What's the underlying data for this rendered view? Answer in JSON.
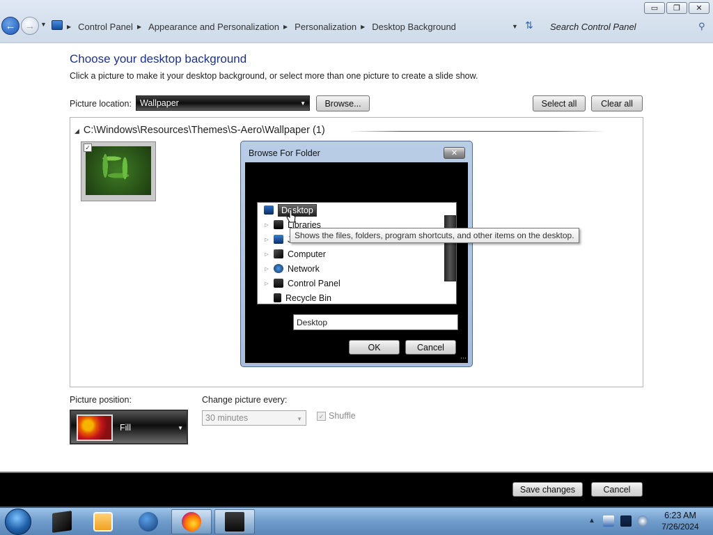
{
  "window": {
    "minimize_glyph": "▭",
    "maximize_glyph": "❐",
    "close_glyph": "✕"
  },
  "address_bar": {
    "back_icon": "back-arrow-icon",
    "forward_icon": "forward-arrow-icon",
    "breadcrumb": [
      "Control Panel",
      "Appearance and Personalization",
      "Personalization",
      "Desktop Background"
    ],
    "search_placeholder": "Search Control Panel"
  },
  "main": {
    "title": "Choose your desktop background",
    "subtitle": "Click a picture to make it your desktop background, or select more than one picture to create a slide show.",
    "picture_location_label": "Picture location:",
    "picture_location_value": "Wallpaper",
    "browse_label": "Browse...",
    "select_all_label": "Select all",
    "clear_all_label": "Clear all",
    "group_header": "C:\\Windows\\Resources\\Themes\\S-Aero\\Wallpaper (1)",
    "thumbnails": [
      {
        "checked": true,
        "subject": "green-leaves"
      }
    ]
  },
  "dialog": {
    "title": "Browse For Folder",
    "close_label": "✕",
    "tree_items": [
      {
        "label": "Desktop",
        "icon": "desktop-icon",
        "selected": true,
        "expandable": false
      },
      {
        "label": "Libraries",
        "icon": "libraries-icon",
        "expandable": true
      },
      {
        "label": "Jo",
        "icon": "user-folder-icon",
        "expandable": true
      },
      {
        "label": "Computer",
        "icon": "computer-icon",
        "expandable": true
      },
      {
        "label": "Network",
        "icon": "network-icon",
        "expandable": true
      },
      {
        "label": "Control Panel",
        "icon": "control-panel-icon",
        "expandable": true
      },
      {
        "label": "Recycle Bin",
        "icon": "recycle-bin-icon",
        "expandable": false
      }
    ],
    "folder_value": "Desktop",
    "ok_label": "OK",
    "cancel_label": "Cancel",
    "tooltip": "Shows the files, folders, program shortcuts, and other items on the desktop."
  },
  "bottom": {
    "picture_position_label": "Picture position:",
    "picture_position_value": "Fill",
    "change_every_label": "Change picture every:",
    "change_every_value": "30 minutes",
    "shuffle_label": "Shuffle",
    "shuffle_checked": true
  },
  "footer": {
    "save_label": "Save changes",
    "cancel_label": "Cancel"
  },
  "taskbar": {
    "items": [
      "start-orb",
      "explorer",
      "media-player",
      "internet-explorer",
      "firefox",
      "control-panel"
    ],
    "time": "6:23 AM",
    "date": "7/26/2024"
  }
}
